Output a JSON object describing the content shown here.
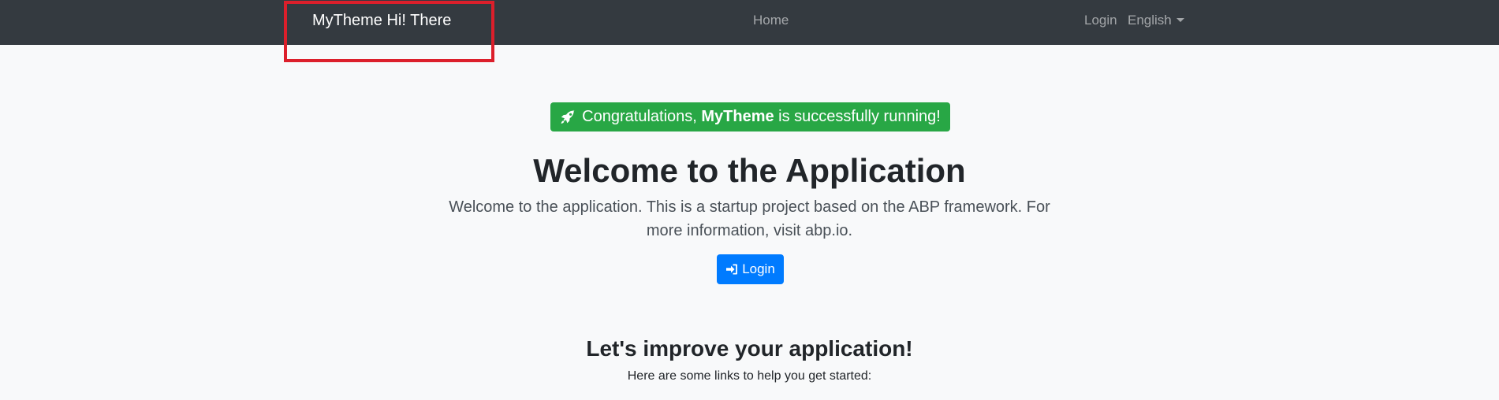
{
  "navbar": {
    "brand": "MyTheme Hi! There",
    "home": "Home",
    "login": "Login",
    "language": "English"
  },
  "hero": {
    "badge_prefix": "Congratulations, ",
    "badge_app": "MyTheme",
    "badge_suffix": " is successfully running!",
    "title": "Welcome to the Application",
    "lead": "Welcome to the application. This is a startup project based on the ABP framework. For more information, visit abp.io.",
    "login_button": "Login"
  },
  "improve": {
    "title": "Let's improve your application!",
    "subtitle": "Here are some links to help you get started:"
  },
  "colors": {
    "navbar_bg": "#343a40",
    "success": "#28a745",
    "primary": "#007bff",
    "highlight": "#dc1f2b"
  }
}
